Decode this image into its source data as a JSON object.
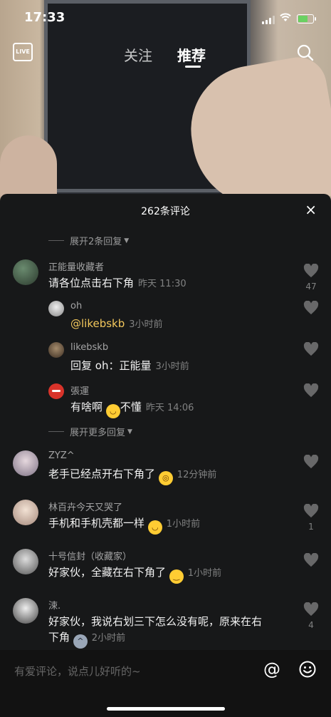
{
  "status_bar": {
    "time": "17:33"
  },
  "nav": {
    "live_label": "LIVE",
    "tabs": [
      {
        "label": "关注"
      },
      {
        "label": "推荐"
      }
    ]
  },
  "comments_sheet": {
    "title": "262条评论",
    "close": "×",
    "expand_1": "展开2条回复",
    "expand_2": "展开更多回复",
    "comments": [
      {
        "user": "正能量收藏者",
        "text": "请各位点击右下角",
        "time": "昨天 11:30",
        "likes": "47"
      },
      {
        "user": "oh",
        "mention": "@likebskb",
        "text": "",
        "time": "3小时前",
        "likes": ""
      },
      {
        "user": "likebskb",
        "text": "回复 oh：正能量",
        "time": "3小时前",
        "likes": ""
      },
      {
        "user": "張運",
        "text_before": "有啥啊",
        "text_after": "不懂",
        "time": "昨天 14:06",
        "likes": ""
      },
      {
        "user": "ZYZ^",
        "text": "老手已经点开右下角了",
        "time": "12分钟前",
        "likes": ""
      },
      {
        "user": "林百卉今天又哭了",
        "text": "手机和手机壳都一样",
        "time": "1小时前",
        "likes": "1"
      },
      {
        "user": "十号信封（收藏家）",
        "text": "好家伙，全藏在右下角了",
        "time": "1小时前",
        "likes": ""
      },
      {
        "user": "涑.",
        "text_line1": "好家伙，我说右划三下怎么没有呢，原来在右",
        "text_line2": "下角",
        "time": "2小时前",
        "likes": "4"
      }
    ]
  },
  "input": {
    "placeholder": "有爱评论，说点儿好听的~",
    "at_label": "@"
  },
  "icons": [
    "live-icon",
    "search-icon",
    "close-icon",
    "heart-icon",
    "at-icon",
    "emoji-icon"
  ]
}
